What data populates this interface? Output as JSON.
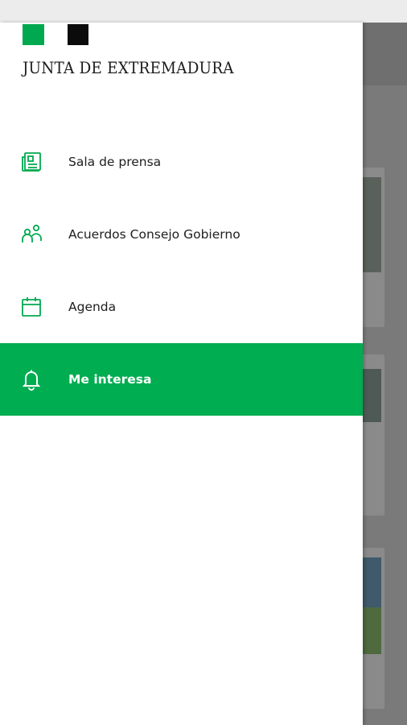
{
  "brand": {
    "name": "JUNTA DE EXTREMADURA",
    "logo_colors": [
      "#00a94f",
      "#0b0b0b"
    ]
  },
  "theme": {
    "accent": "#00ad50",
    "icon": "#00a94f",
    "text": "#202020",
    "scrim": "#7a7a7a"
  },
  "menu": {
    "items": [
      {
        "label": "Sala de prensa",
        "icon": "newspaper-icon",
        "active": false
      },
      {
        "label": "Acuerdos Consejo Gobierno",
        "icon": "people-icon",
        "active": false
      },
      {
        "label": "Agenda",
        "icon": "calendar-icon",
        "active": false
      },
      {
        "label": "Me interesa",
        "icon": "bell-icon",
        "active": true
      }
    ]
  }
}
